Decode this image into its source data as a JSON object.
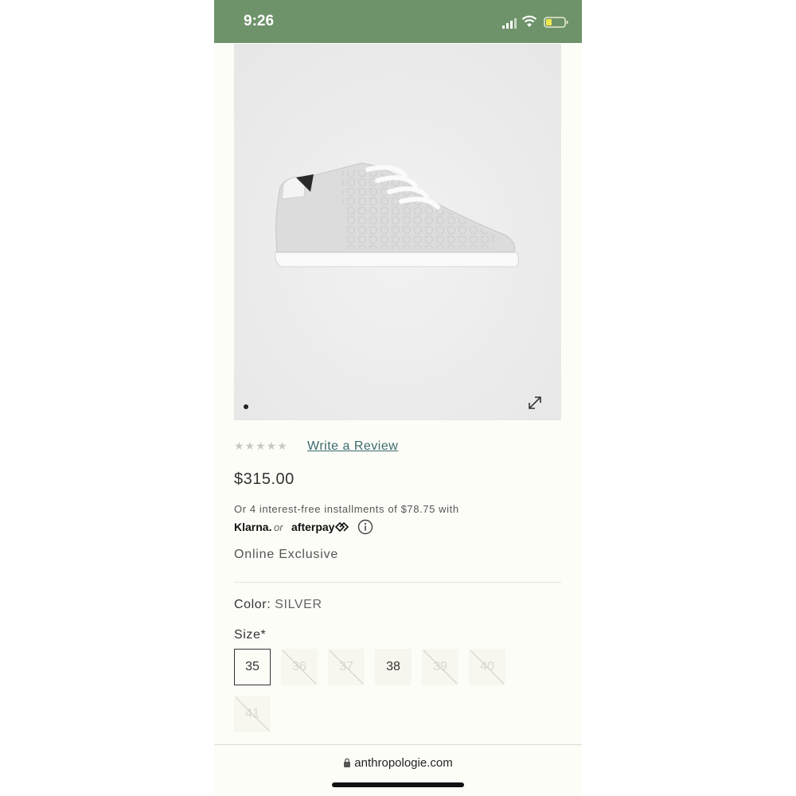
{
  "status_bar": {
    "time": "9:26"
  },
  "product": {
    "rating_stars": "★★★★★",
    "write_review": "Write a Review",
    "price": "$315.00",
    "installments_text": "Or 4 interest-free installments of $78.75 with",
    "klarna": "Klarna.",
    "or": "or",
    "afterpay": "afterpay",
    "availability": "Online Exclusive",
    "color_label": "Color:",
    "color_value": "SILVER",
    "size_label": "Size*",
    "sizes": [
      {
        "label": "35",
        "state": "selected"
      },
      {
        "label": "36",
        "state": "unavailable"
      },
      {
        "label": "37",
        "state": "unavailable"
      },
      {
        "label": "38",
        "state": "available"
      },
      {
        "label": "39",
        "state": "unavailable"
      },
      {
        "label": "40",
        "state": "unavailable"
      },
      {
        "label": "41",
        "state": "unavailable"
      }
    ]
  },
  "browser": {
    "url": "anthropologie.com"
  },
  "icons": [
    "signal-icon",
    "wifi-icon",
    "battery-icon",
    "expand-icon",
    "info-icon",
    "lock-icon"
  ],
  "colors": {
    "status_bar": "#6e926a",
    "link": "#3b6a6d",
    "background": "#fdfdf8"
  }
}
